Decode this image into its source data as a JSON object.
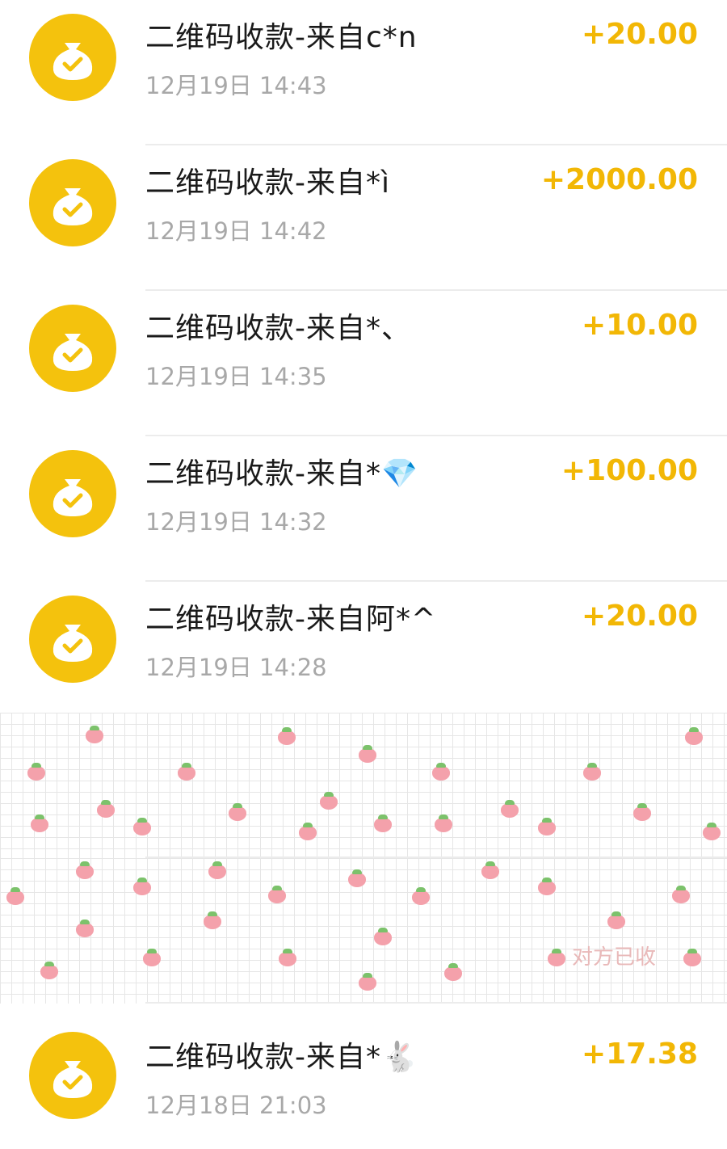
{
  "transactions": [
    {
      "title": "二维码收款-来自c*n",
      "time": "12月19日 14:43",
      "amount": "+20.00"
    },
    {
      "title": "二维码收款-来自*ì",
      "time": "12月19日 14:42",
      "amount": "+2000.00"
    },
    {
      "title": "二维码收款-来自*、",
      "time": "12月19日 14:35",
      "amount": "+10.00"
    },
    {
      "title": "二维码收款-来自*💎",
      "time": "12月19日 14:32",
      "amount": "+100.00"
    },
    {
      "title": "二维码收款-来自阿*^",
      "time": "12月19日 14:28",
      "amount": "+20.00"
    },
    {
      "title": "二维码收款-来自*🐇",
      "time": "12月18日 21:03",
      "amount": "+17.38"
    }
  ],
  "redacted_rows": [
    {
      "visible_fragment": ""
    },
    {
      "visible_fragment": "对方已收"
    }
  ],
  "icons": {
    "transaction_icon": "money-bag-check-icon",
    "accent_color": "#f4c20d",
    "amount_color": "#f2b705"
  }
}
